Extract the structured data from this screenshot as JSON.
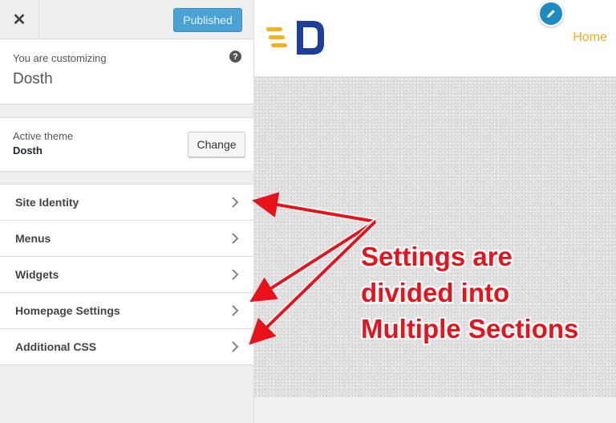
{
  "topbar": {
    "close_icon": "close-icon",
    "close_glyph": "✕",
    "publish_label": "Published"
  },
  "info": {
    "label": "You are customizing",
    "site_name": "Dosth",
    "help_icon": "help-icon",
    "help_glyph": "?"
  },
  "theme": {
    "label": "Active theme",
    "name": "Dosth",
    "change_label": "Change"
  },
  "sections": [
    {
      "label": "Site Identity"
    },
    {
      "label": "Menus"
    },
    {
      "label": "Widgets"
    },
    {
      "label": "Homepage Settings"
    },
    {
      "label": "Additional CSS"
    }
  ],
  "preview": {
    "nav_home": "Home",
    "edit_icon": "pencil-icon"
  },
  "annotation": {
    "line1": "Settings are",
    "line2": "divided into",
    "line3": "Multiple Sections"
  },
  "colors": {
    "accent_blue": "#1e8cbe",
    "publish_blue": "#4aa3d4",
    "link_orange": "#f4a91f",
    "annotation_red": "#e9121b",
    "logo_blue": "#1d3f99",
    "logo_yellow": "#f5b31b"
  }
}
